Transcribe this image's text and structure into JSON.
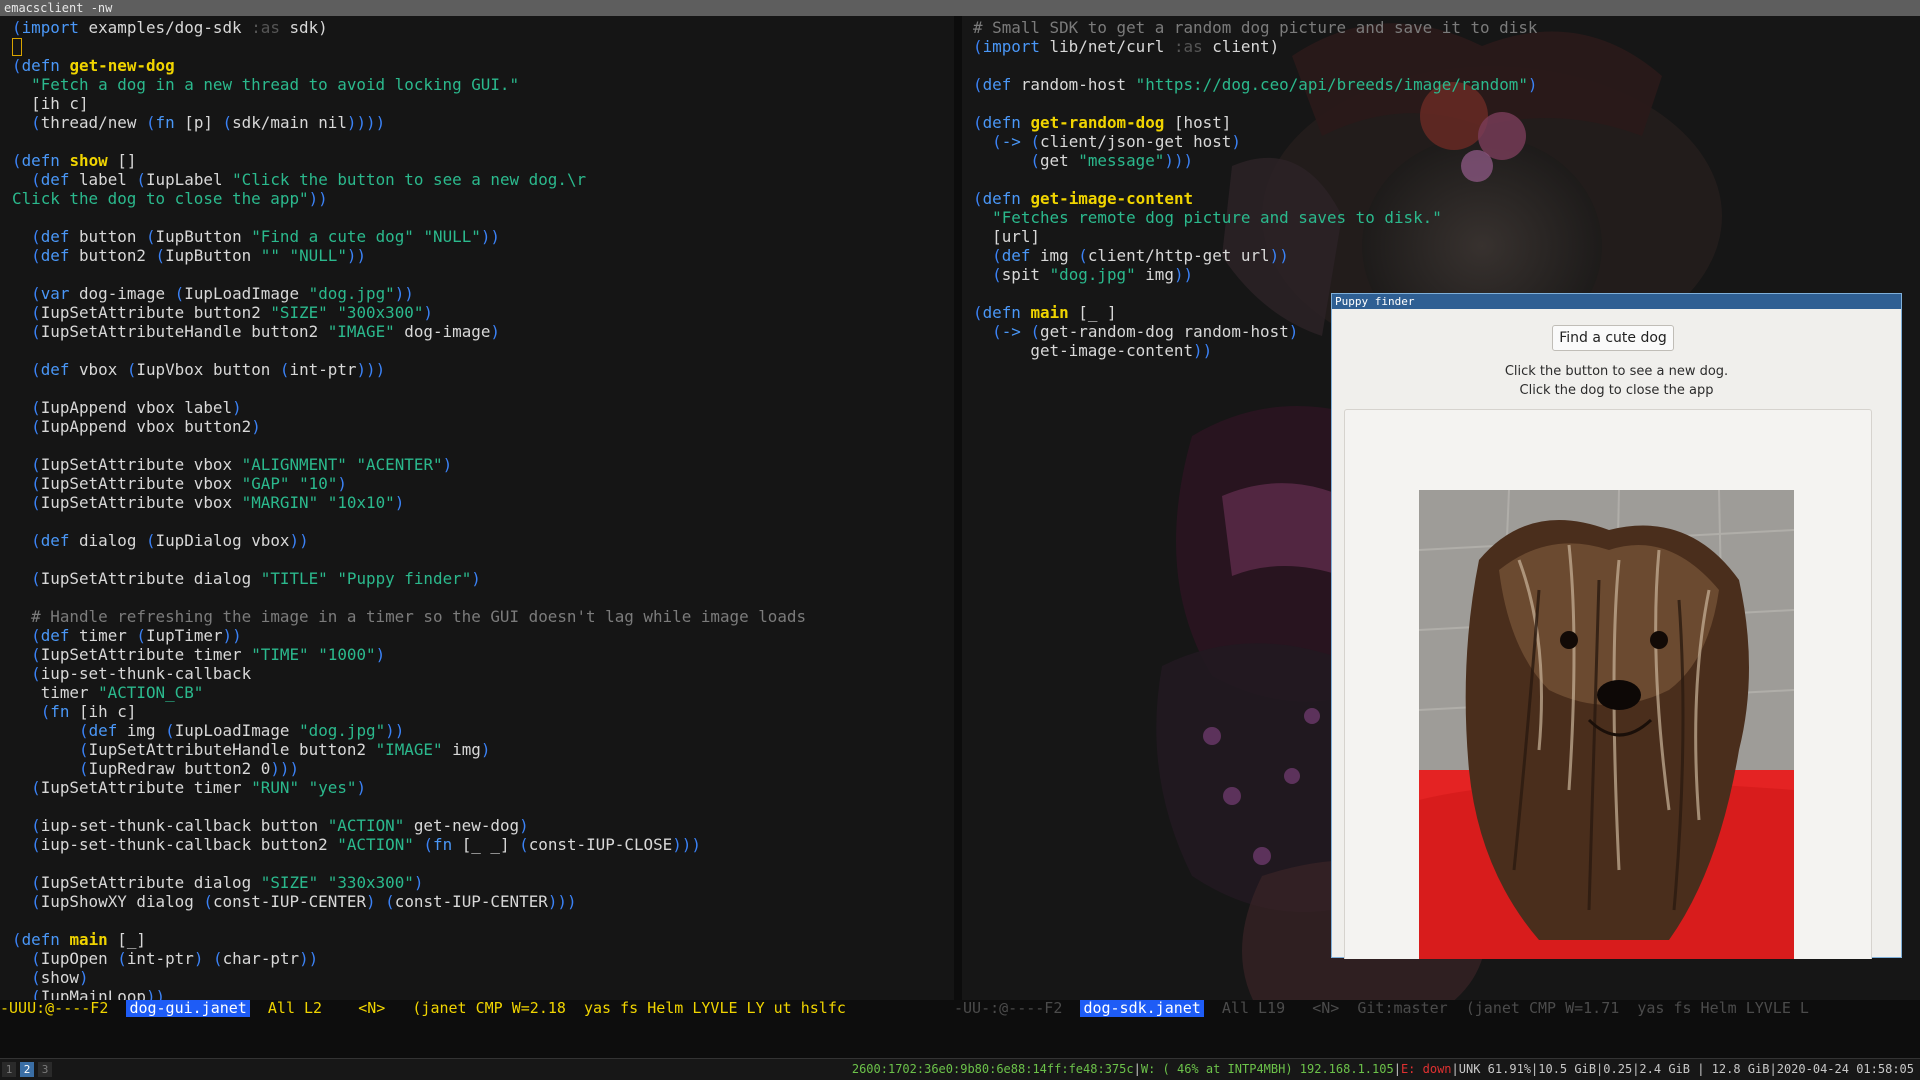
{
  "window_title": "emacsclient -nw",
  "left_buffer": {
    "filename": "dog-gui.janet",
    "code": [
      [
        "(",
        "p"
      ],
      [
        "import",
        "k"
      ],
      [
        " examples/dog-sdk ",
        ""
      ],
      [
        ":as",
        "kw"
      ],
      [
        " sdk)",
        ""
      ],
      [
        "\n",
        ""
      ],
      [
        "CURSOR",
        "cursor"
      ],
      [
        "\n",
        ""
      ],
      [
        "(",
        "p"
      ],
      [
        "defn",
        "k"
      ],
      [
        " ",
        ""
      ],
      [
        "get-new-dog",
        "y"
      ],
      [
        "\n",
        ""
      ],
      [
        "  ",
        ""
      ],
      [
        "\"Fetch a dog in a new thread to avoid locking GUI.\"",
        "s"
      ],
      [
        "\n",
        ""
      ],
      [
        "  [ih c]",
        ""
      ],
      [
        "\n",
        ""
      ],
      [
        "  ",
        ""
      ],
      [
        "(",
        "p"
      ],
      [
        "thread/new ",
        ""
      ],
      [
        "(",
        "p"
      ],
      [
        "fn",
        "k"
      ],
      [
        " [p] ",
        ""
      ],
      [
        "(",
        "p"
      ],
      [
        "sdk/main nil",
        ""
      ],
      [
        "))))",
        "p"
      ],
      [
        "\n\n",
        ""
      ],
      [
        "(",
        "p"
      ],
      [
        "defn",
        "k"
      ],
      [
        " ",
        ""
      ],
      [
        "show",
        "y"
      ],
      [
        " []",
        ""
      ],
      [
        "\n",
        ""
      ],
      [
        "  ",
        ""
      ],
      [
        "(",
        "p"
      ],
      [
        "def",
        "k"
      ],
      [
        " label ",
        ""
      ],
      [
        "(",
        "p"
      ],
      [
        "IupLabel ",
        ""
      ],
      [
        "\"Click the button to see a new dog.\\r\nClick the dog to close the app\"",
        "s"
      ],
      [
        "))",
        "p"
      ],
      [
        "\n\n",
        ""
      ],
      [
        "  ",
        ""
      ],
      [
        "(",
        "p"
      ],
      [
        "def",
        "k"
      ],
      [
        " button ",
        ""
      ],
      [
        "(",
        "p"
      ],
      [
        "IupButton ",
        ""
      ],
      [
        "\"Find a cute dog\"",
        "s"
      ],
      [
        " ",
        ""
      ],
      [
        "\"NULL\"",
        "s"
      ],
      [
        "))",
        "p"
      ],
      [
        "\n",
        ""
      ],
      [
        "  ",
        ""
      ],
      [
        "(",
        "p"
      ],
      [
        "def",
        "k"
      ],
      [
        " button2 ",
        ""
      ],
      [
        "(",
        "p"
      ],
      [
        "IupButton ",
        ""
      ],
      [
        "\"\"",
        "s"
      ],
      [
        " ",
        ""
      ],
      [
        "\"NULL\"",
        "s"
      ],
      [
        "))",
        "p"
      ],
      [
        "\n\n",
        ""
      ],
      [
        "  ",
        ""
      ],
      [
        "(",
        "p"
      ],
      [
        "var",
        "k"
      ],
      [
        " dog-image ",
        ""
      ],
      [
        "(",
        "p"
      ],
      [
        "IupLoadImage ",
        ""
      ],
      [
        "\"dog.jpg\"",
        "s"
      ],
      [
        "))",
        "p"
      ],
      [
        "\n",
        ""
      ],
      [
        "  ",
        ""
      ],
      [
        "(",
        "p"
      ],
      [
        "IupSetAttribute button2 ",
        ""
      ],
      [
        "\"SIZE\"",
        "s"
      ],
      [
        " ",
        ""
      ],
      [
        "\"300x300\"",
        "s"
      ],
      [
        ")",
        "p"
      ],
      [
        "\n",
        ""
      ],
      [
        "  ",
        ""
      ],
      [
        "(",
        "p"
      ],
      [
        "IupSetAttributeHandle button2 ",
        ""
      ],
      [
        "\"IMAGE\"",
        "s"
      ],
      [
        " dog-image",
        ""
      ],
      [
        ")",
        "p"
      ],
      [
        "\n\n",
        ""
      ],
      [
        "  ",
        ""
      ],
      [
        "(",
        "p"
      ],
      [
        "def",
        "k"
      ],
      [
        " vbox ",
        ""
      ],
      [
        "(",
        "p"
      ],
      [
        "IupVbox button ",
        ""
      ],
      [
        "(",
        "p"
      ],
      [
        "int-ptr",
        ""
      ],
      [
        "))",
        "p"
      ],
      [
        ")",
        "p"
      ],
      [
        "\n\n",
        ""
      ],
      [
        "  ",
        ""
      ],
      [
        "(",
        "p"
      ],
      [
        "IupAppend vbox label",
        ""
      ],
      [
        ")",
        "p"
      ],
      [
        "\n",
        ""
      ],
      [
        "  ",
        ""
      ],
      [
        "(",
        "p"
      ],
      [
        "IupAppend vbox button2",
        ""
      ],
      [
        ")",
        "p"
      ],
      [
        "\n\n",
        ""
      ],
      [
        "  ",
        ""
      ],
      [
        "(",
        "p"
      ],
      [
        "IupSetAttribute vbox ",
        ""
      ],
      [
        "\"ALIGNMENT\"",
        "s"
      ],
      [
        " ",
        ""
      ],
      [
        "\"ACENTER\"",
        "s"
      ],
      [
        ")",
        "p"
      ],
      [
        "\n",
        ""
      ],
      [
        "  ",
        ""
      ],
      [
        "(",
        "p"
      ],
      [
        "IupSetAttribute vbox ",
        ""
      ],
      [
        "\"GAP\"",
        "s"
      ],
      [
        " ",
        ""
      ],
      [
        "\"10\"",
        "s"
      ],
      [
        ")",
        "p"
      ],
      [
        "\n",
        ""
      ],
      [
        "  ",
        ""
      ],
      [
        "(",
        "p"
      ],
      [
        "IupSetAttribute vbox ",
        ""
      ],
      [
        "\"MARGIN\"",
        "s"
      ],
      [
        " ",
        ""
      ],
      [
        "\"10x10\"",
        "s"
      ],
      [
        ")",
        "p"
      ],
      [
        "\n\n",
        ""
      ],
      [
        "  ",
        ""
      ],
      [
        "(",
        "p"
      ],
      [
        "def",
        "k"
      ],
      [
        " dialog ",
        ""
      ],
      [
        "(",
        "p"
      ],
      [
        "IupDialog vbox",
        ""
      ],
      [
        "))",
        "p"
      ],
      [
        "\n\n",
        ""
      ],
      [
        "  ",
        ""
      ],
      [
        "(",
        "p"
      ],
      [
        "IupSetAttribute dialog ",
        ""
      ],
      [
        "\"TITLE\"",
        "s"
      ],
      [
        " ",
        ""
      ],
      [
        "\"Puppy finder\"",
        "s"
      ],
      [
        ")",
        "p"
      ],
      [
        "\n\n",
        ""
      ],
      [
        "  ",
        ""
      ],
      [
        "# Handle refreshing the image in a timer so the GUI doesn't lag while image loads",
        "c"
      ],
      [
        "\n",
        ""
      ],
      [
        "  ",
        ""
      ],
      [
        "(",
        "p"
      ],
      [
        "def",
        "k"
      ],
      [
        " timer ",
        ""
      ],
      [
        "(",
        "p"
      ],
      [
        "IupTimer",
        ""
      ],
      [
        "))",
        "p"
      ],
      [
        "\n",
        ""
      ],
      [
        "  ",
        ""
      ],
      [
        "(",
        "p"
      ],
      [
        "IupSetAttribute timer ",
        ""
      ],
      [
        "\"TIME\"",
        "s"
      ],
      [
        " ",
        ""
      ],
      [
        "\"1000\"",
        "s"
      ],
      [
        ")",
        "p"
      ],
      [
        "\n",
        ""
      ],
      [
        "  ",
        ""
      ],
      [
        "(",
        "p"
      ],
      [
        "iup-set-thunk-callback",
        ""
      ],
      [
        "\n",
        ""
      ],
      [
        "   timer ",
        ""
      ],
      [
        "\"ACTION_CB\"",
        "s"
      ],
      [
        "\n",
        ""
      ],
      [
        "   ",
        ""
      ],
      [
        "(",
        "p"
      ],
      [
        "fn",
        "k"
      ],
      [
        " [ih c]",
        ""
      ],
      [
        "\n",
        ""
      ],
      [
        "       ",
        ""
      ],
      [
        "(",
        "p"
      ],
      [
        "def",
        "k"
      ],
      [
        " img ",
        ""
      ],
      [
        "(",
        "p"
      ],
      [
        "IupLoadImage ",
        ""
      ],
      [
        "\"dog.jpg\"",
        "s"
      ],
      [
        "))",
        "p"
      ],
      [
        "\n",
        ""
      ],
      [
        "       ",
        ""
      ],
      [
        "(",
        "p"
      ],
      [
        "IupSetAttributeHandle button2 ",
        ""
      ],
      [
        "\"IMAGE\"",
        "s"
      ],
      [
        " img",
        ""
      ],
      [
        ")",
        "p"
      ],
      [
        "\n",
        ""
      ],
      [
        "       ",
        ""
      ],
      [
        "(",
        "p"
      ],
      [
        "IupRedraw button2 0",
        ""
      ],
      [
        ")))",
        "p"
      ],
      [
        "\n",
        ""
      ],
      [
        "  ",
        ""
      ],
      [
        "(",
        "p"
      ],
      [
        "IupSetAttribute timer ",
        ""
      ],
      [
        "\"RUN\"",
        "s"
      ],
      [
        " ",
        ""
      ],
      [
        "\"yes\"",
        "s"
      ],
      [
        ")",
        "p"
      ],
      [
        "\n\n",
        ""
      ],
      [
        "  ",
        ""
      ],
      [
        "(",
        "p"
      ],
      [
        "iup-set-thunk-callback button ",
        ""
      ],
      [
        "\"ACTION\"",
        "s"
      ],
      [
        " get-new-dog",
        ""
      ],
      [
        ")",
        "p"
      ],
      [
        "\n",
        ""
      ],
      [
        "  ",
        ""
      ],
      [
        "(",
        "p"
      ],
      [
        "iup-set-thunk-callback button2 ",
        ""
      ],
      [
        "\"ACTION\"",
        "s"
      ],
      [
        " ",
        ""
      ],
      [
        "(",
        "p"
      ],
      [
        "fn",
        "k"
      ],
      [
        " [_ _] ",
        ""
      ],
      [
        "(",
        "p"
      ],
      [
        "const-IUP-CLOSE",
        ""
      ],
      [
        ")))",
        "p"
      ],
      [
        "\n\n",
        ""
      ],
      [
        "  ",
        ""
      ],
      [
        "(",
        "p"
      ],
      [
        "IupSetAttribute dialog ",
        ""
      ],
      [
        "\"SIZE\"",
        "s"
      ],
      [
        " ",
        ""
      ],
      [
        "\"330x300\"",
        "s"
      ],
      [
        ")",
        "p"
      ],
      [
        "\n",
        ""
      ],
      [
        "  ",
        ""
      ],
      [
        "(",
        "p"
      ],
      [
        "IupShowXY dialog ",
        ""
      ],
      [
        "(",
        "p"
      ],
      [
        "const-IUP-CENTER",
        ""
      ],
      [
        ")",
        "p"
      ],
      [
        " ",
        ""
      ],
      [
        "(",
        "p"
      ],
      [
        "const-IUP-CENTER",
        ""
      ],
      [
        "))",
        "p"
      ],
      [
        ")",
        "p"
      ],
      [
        "\n\n",
        ""
      ],
      [
        "(",
        "p"
      ],
      [
        "defn",
        "k"
      ],
      [
        " ",
        ""
      ],
      [
        "main",
        "y"
      ],
      [
        " [_]",
        ""
      ],
      [
        "\n",
        ""
      ],
      [
        "  ",
        ""
      ],
      [
        "(",
        "p"
      ],
      [
        "IupOpen ",
        ""
      ],
      [
        "(",
        "p"
      ],
      [
        "int-ptr",
        ""
      ],
      [
        ")",
        "p"
      ],
      [
        " ",
        ""
      ],
      [
        "(",
        "p"
      ],
      [
        "char-ptr",
        ""
      ],
      [
        "))",
        "p"
      ],
      [
        "\n",
        ""
      ],
      [
        "  ",
        ""
      ],
      [
        "(",
        "p"
      ],
      [
        "show",
        ""
      ],
      [
        ")",
        "p"
      ],
      [
        "\n",
        ""
      ],
      [
        "  ",
        ""
      ],
      [
        "(",
        "p"
      ],
      [
        "IupMainLoop",
        ""
      ],
      [
        "))",
        "p"
      ]
    ],
    "modeline_prefix": "-UUU:@----F2  ",
    "modeline_suffix": "  All L2    <N>   (janet CMP W=2.18  yas fs Helm LYVLE LY ut hslfc"
  },
  "right_buffer": {
    "filename": "dog-sdk.janet",
    "code": [
      [
        "# Small SDK to get a random dog picture and save it to disk",
        "c"
      ],
      [
        "\n",
        ""
      ],
      [
        "(",
        "p"
      ],
      [
        "import",
        "k"
      ],
      [
        " lib/net/curl ",
        ""
      ],
      [
        ":as",
        "kw"
      ],
      [
        " client)",
        ""
      ],
      [
        "\n\n",
        ""
      ],
      [
        "(",
        "p"
      ],
      [
        "def",
        "k"
      ],
      [
        " random-host ",
        ""
      ],
      [
        "\"https://dog.ceo/api/breeds/image/random\"",
        "s"
      ],
      [
        ")",
        "p"
      ],
      [
        "\n\n",
        ""
      ],
      [
        "(",
        "p"
      ],
      [
        "defn",
        "k"
      ],
      [
        " ",
        ""
      ],
      [
        "get-random-dog",
        "y"
      ],
      [
        " [host]",
        ""
      ],
      [
        "\n",
        ""
      ],
      [
        "  ",
        ""
      ],
      [
        "(",
        "p"
      ],
      [
        "->",
        "k"
      ],
      [
        " ",
        ""
      ],
      [
        "(",
        "p"
      ],
      [
        "client/json-get host",
        ""
      ],
      [
        ")",
        "p"
      ],
      [
        "\n",
        ""
      ],
      [
        "      ",
        ""
      ],
      [
        "(",
        "p"
      ],
      [
        "get ",
        ""
      ],
      [
        "\"message\"",
        "s"
      ],
      [
        ")))",
        "p"
      ],
      [
        "\n\n",
        ""
      ],
      [
        "(",
        "p"
      ],
      [
        "defn",
        "k"
      ],
      [
        " ",
        ""
      ],
      [
        "get-image-content",
        "y"
      ],
      [
        "\n",
        ""
      ],
      [
        "  ",
        ""
      ],
      [
        "\"Fetches remote dog picture and saves to disk.\"",
        "s"
      ],
      [
        "\n",
        ""
      ],
      [
        "  [url]",
        ""
      ],
      [
        "\n",
        ""
      ],
      [
        "  ",
        ""
      ],
      [
        "(",
        "p"
      ],
      [
        "def",
        "k"
      ],
      [
        " img ",
        ""
      ],
      [
        "(",
        "p"
      ],
      [
        "client/http-get url",
        ""
      ],
      [
        "))",
        "p"
      ],
      [
        "\n",
        ""
      ],
      [
        "  ",
        ""
      ],
      [
        "(",
        "p"
      ],
      [
        "spit ",
        ""
      ],
      [
        "\"dog.jpg\"",
        "s"
      ],
      [
        " img",
        ""
      ],
      [
        "))",
        "p"
      ],
      [
        "\n\n",
        ""
      ],
      [
        "(",
        "p"
      ],
      [
        "defn",
        "k"
      ],
      [
        " ",
        ""
      ],
      [
        "main",
        "y"
      ],
      [
        " [_ ]",
        ""
      ],
      [
        "\n",
        ""
      ],
      [
        "  ",
        ""
      ],
      [
        "(",
        "p"
      ],
      [
        "->",
        "k"
      ],
      [
        " ",
        ""
      ],
      [
        "(",
        "p"
      ],
      [
        "get-random-dog random-host",
        ""
      ],
      [
        ")",
        "p"
      ],
      [
        "\n",
        ""
      ],
      [
        "      get-image-content",
        ""
      ],
      [
        "))",
        "p"
      ]
    ],
    "modeline_prefix": "-UU-:@----F2  ",
    "modeline_suffix": "  All L19   <N>  Git:master  (janet CMP W=1.71  yas fs Helm LYVLE L"
  },
  "dialog": {
    "title": "Puppy finder",
    "button_label": "Find a cute dog",
    "label_line1": "Click the button to see a new dog.",
    "label_line2": "Click the dog to close the app"
  },
  "statusbar": {
    "workspaces": [
      "1",
      "2",
      "3"
    ],
    "active_workspace": "2",
    "ipv6": "2600:1702:36e0:9b80:6e88:14ff:fe48:375c",
    "wireless": "W: ( 46% at INTP4MBH) 192.168.1.105",
    "ethernet": "E: down",
    "battery": "UNK 61.91%",
    "disk": "10.5 GiB",
    "load": "0.25",
    "mem_used": "2.4 GiB",
    "mem_free": "12.8 GiB",
    "datetime": "2020-04-24 01:58:05"
  },
  "colors": {
    "paren": "#3b82f6",
    "keyword": "#4a97f7",
    "definition_name": "#f0d400",
    "string": "#2bb98d",
    "comment": "#7b7b7b",
    "modeline_buffer_bg": "#1e5cf6",
    "dialog_title_bg": "#2f5f93"
  }
}
